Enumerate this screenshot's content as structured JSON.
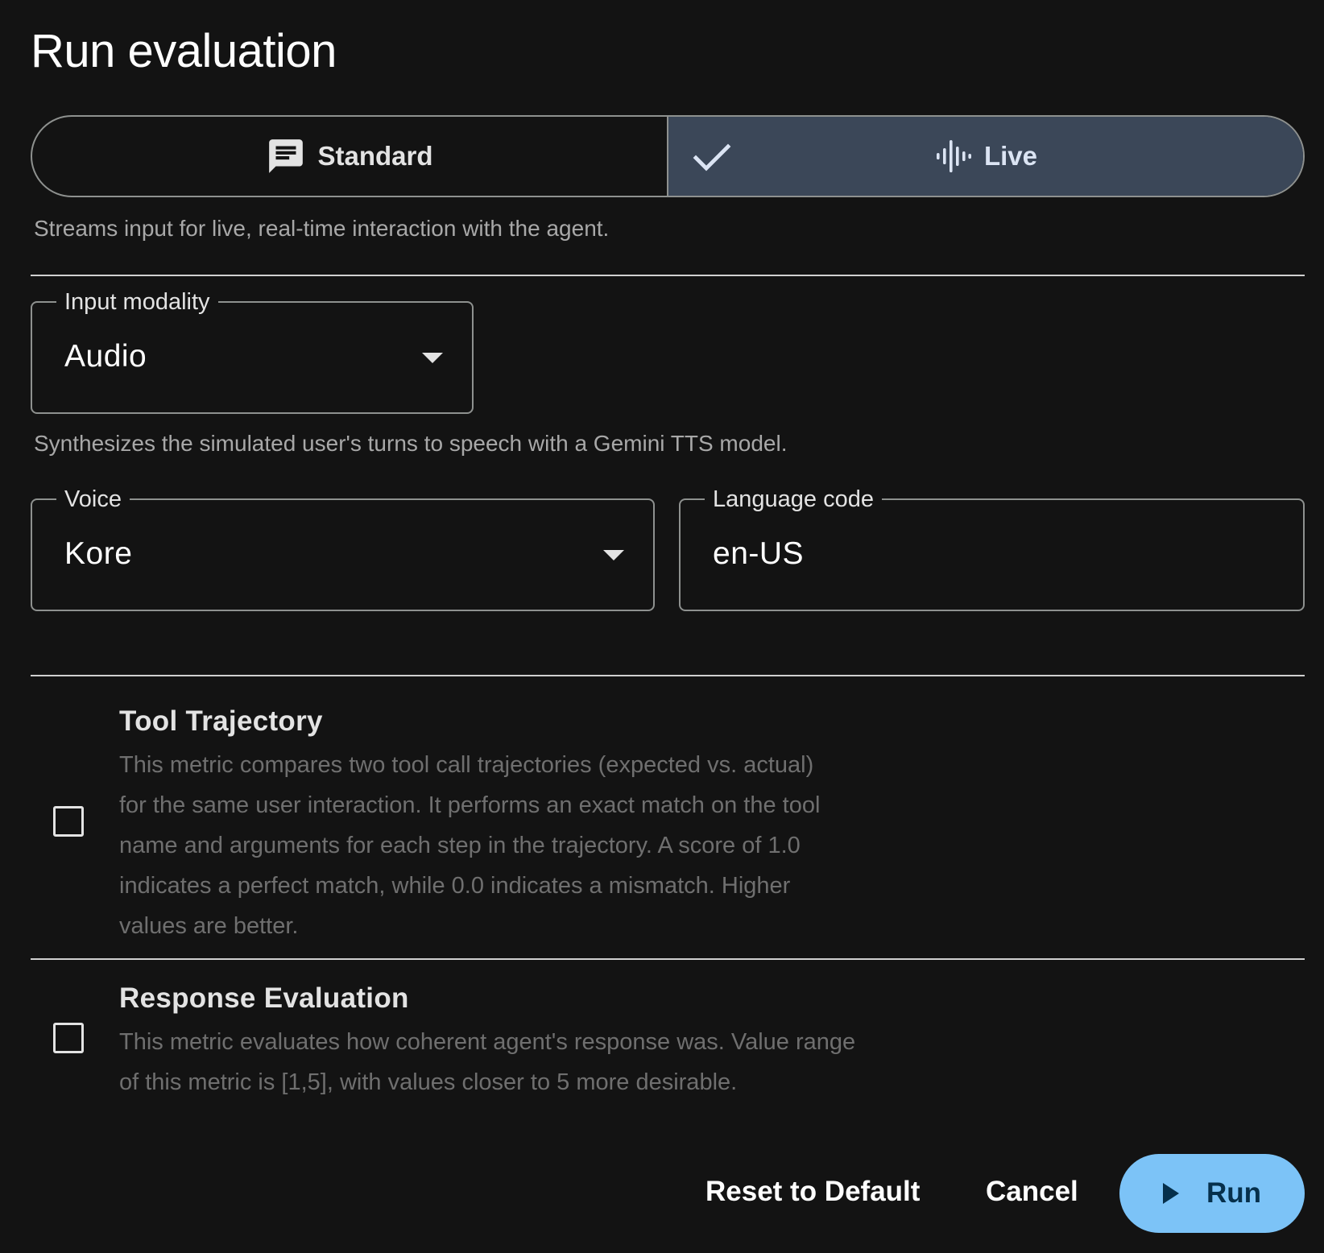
{
  "dialog": {
    "title": "Run evaluation"
  },
  "mode_toggle": {
    "options": [
      {
        "label": "Standard",
        "icon": "chat-icon",
        "selected": false
      },
      {
        "label": "Live",
        "icon": "audio-waveform-icon",
        "selected": true
      }
    ],
    "description": "Streams input for live, real-time interaction with the agent."
  },
  "input_modality": {
    "label": "Input modality",
    "value": "Audio",
    "description": "Synthesizes the simulated user's turns to speech with a Gemini TTS model."
  },
  "voice": {
    "label": "Voice",
    "value": "Kore"
  },
  "language_code": {
    "label": "Language code",
    "value": "en-US"
  },
  "metrics": [
    {
      "title": "Tool Trajectory",
      "checked": false,
      "description_lines": [
        "This metric compares two tool call trajectories (expected vs. actual)",
        "for the same user interaction. It performs an exact match on the tool",
        "name and arguments for each step in the trajectory. A score of 1.0",
        "indicates a perfect match, while 0.0 indicates a mismatch. Higher",
        "values are better."
      ]
    },
    {
      "title": "Response Evaluation",
      "checked": false,
      "description_lines": [
        "This metric evaluates how coherent agent's response was. Value range",
        "of this metric is [1,5], with values closer to 5 more desirable."
      ]
    }
  ],
  "footer": {
    "reset_label": "Reset to Default",
    "cancel_label": "Cancel",
    "run_label": "Run"
  },
  "colors": {
    "background": "#131313",
    "selected_segment": "#3b4758",
    "run_button": "#7cc3f7"
  }
}
